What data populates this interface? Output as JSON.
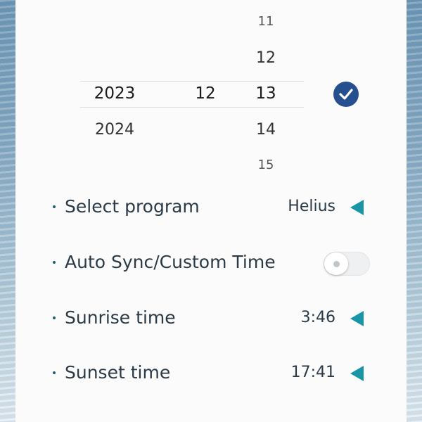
{
  "picker": {
    "years": [
      "2023",
      "2024"
    ],
    "selected_month": "12",
    "days": [
      "11",
      "12",
      "13",
      "14",
      "15"
    ]
  },
  "settings": [
    {
      "label": "Select program",
      "value": "Helius",
      "control": "arrow"
    },
    {
      "label": "Auto Sync/Custom Time",
      "value": "",
      "control": "toggle",
      "toggle_on": false
    },
    {
      "label": "Sunrise time",
      "value": "3:46",
      "control": "arrow"
    },
    {
      "label": "Sunset time",
      "value": "17:41",
      "control": "arrow"
    }
  ],
  "colors": {
    "accent": "#1996a6",
    "confirm": "#264f8f",
    "text": "#2b3a47"
  },
  "icons": {
    "confirm": "check-circle-icon",
    "expand": "triangle-left-icon"
  }
}
